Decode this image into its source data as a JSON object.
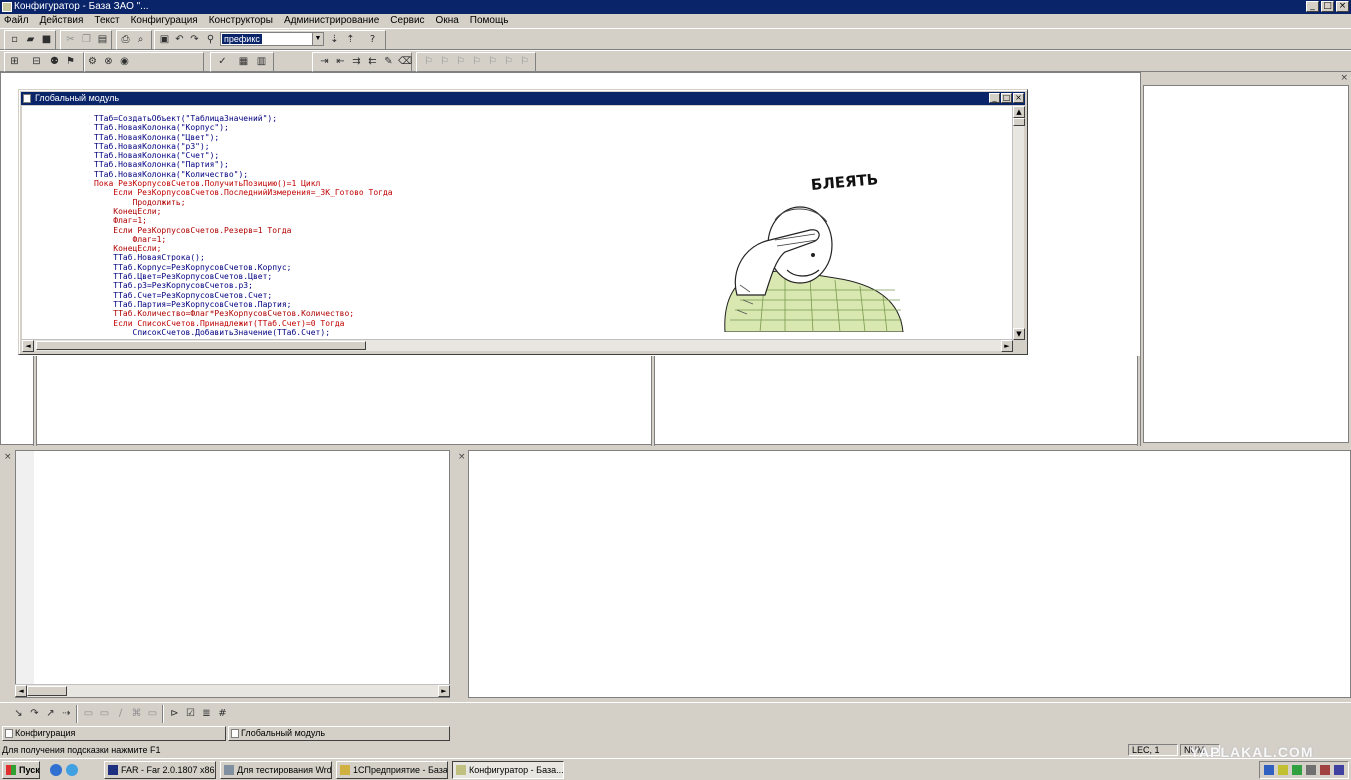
{
  "window": {
    "title": "Конфигуратор - База ЗАО \"..."
  },
  "menu": [
    "Файл",
    "Действия",
    "Текст",
    "Конфигурация",
    "Конструкторы",
    "Администрирование",
    "Сервис",
    "Окна",
    "Помощь"
  ],
  "toolbar": {
    "search_value": "префикс"
  },
  "editor": {
    "title": "Глобальный модуль",
    "code_lines": [
      {
        "t": "ТТаб=СоздатьОбъект(\"ТаблицаЗначений\");",
        "c": "n"
      },
      {
        "t": "ТТаб.НоваяКолонка(\"Корпус\");",
        "c": "n"
      },
      {
        "t": "ТТаб.НоваяКолонка(\"Цвет\");",
        "c": "n"
      },
      {
        "t": "ТТаб.НоваяКолонка(\"р3\");",
        "c": "n"
      },
      {
        "t": "ТТаб.НоваяКолонка(\"Счет\");",
        "c": "n"
      },
      {
        "t": "ТТаб.НоваяКолонка(\"Партия\");",
        "c": "n"
      },
      {
        "t": "ТТаб.НоваяКолонка(\"Количество\");",
        "c": "n"
      },
      {
        "t": "Пока РезКорпусовСчетов.ПолучитьПозицию()=1 Цикл",
        "c": "k"
      },
      {
        "t": "    Если РезКорпусовСчетов.ПоследнийИзмерения=_ЗК_Готово Тогда",
        "c": "k"
      },
      {
        "t": "        Продолжить;",
        "c": "r"
      },
      {
        "t": "    КонецЕсли;",
        "c": "r"
      },
      {
        "t": "    Флаг=1;",
        "c": "r"
      },
      {
        "t": "    Если РезКорпусовСчетов.Резерв=1 Тогда",
        "c": "r"
      },
      {
        "t": "        Флаг=1;",
        "c": "r"
      },
      {
        "t": "    КонецЕсли;",
        "c": "r"
      },
      {
        "t": "    ТТаб.НоваяСтрока();",
        "c": "n"
      },
      {
        "t": "    ТТаб.Корпус=РезКорпусовСчетов.Корпус;",
        "c": "n"
      },
      {
        "t": "    ТТаб.Цвет=РезКорпусовСчетов.Цвет;",
        "c": "n"
      },
      {
        "t": "    ТТаб.р3=РезКорпусовСчетов.р3;",
        "c": "n"
      },
      {
        "t": "    ТТаб.Счет=РезКорпусовСчетов.Счет;",
        "c": "n"
      },
      {
        "t": "    ТТаб.Партия=РезКорпусовСчетов.Партия;",
        "c": "n"
      },
      {
        "t": "    ТТаб.Количество=Флаг*РезКорпусовСчетов.Количество;",
        "c": "r"
      },
      {
        "t": "    Если СписокСчетов.Принадлежит(ТТаб.Счет)=0 Тогда",
        "c": "k"
      },
      {
        "t": "        СписокСчетов.ДобавитьЗначение(ТТаб.Счет);",
        "c": "n"
      }
    ]
  },
  "meme": {
    "caption": "БЛЕЯТЬ"
  },
  "tabs": [
    "Конфигурация",
    "Глобальный модуль"
  ],
  "status": {
    "message": "Для получения подсказки нажмите F1",
    "lang": "LEC, 1",
    "num": "NUM"
  },
  "taskbar": {
    "start": "Пуск",
    "tasks": [
      "FAR - Far 2.0.1807 x86",
      "Для тестирования Wrd...",
      "1СПредприятие - База...",
      "Конфигуратор - База..."
    ]
  },
  "watermark": "YAPLAKAL.COM"
}
